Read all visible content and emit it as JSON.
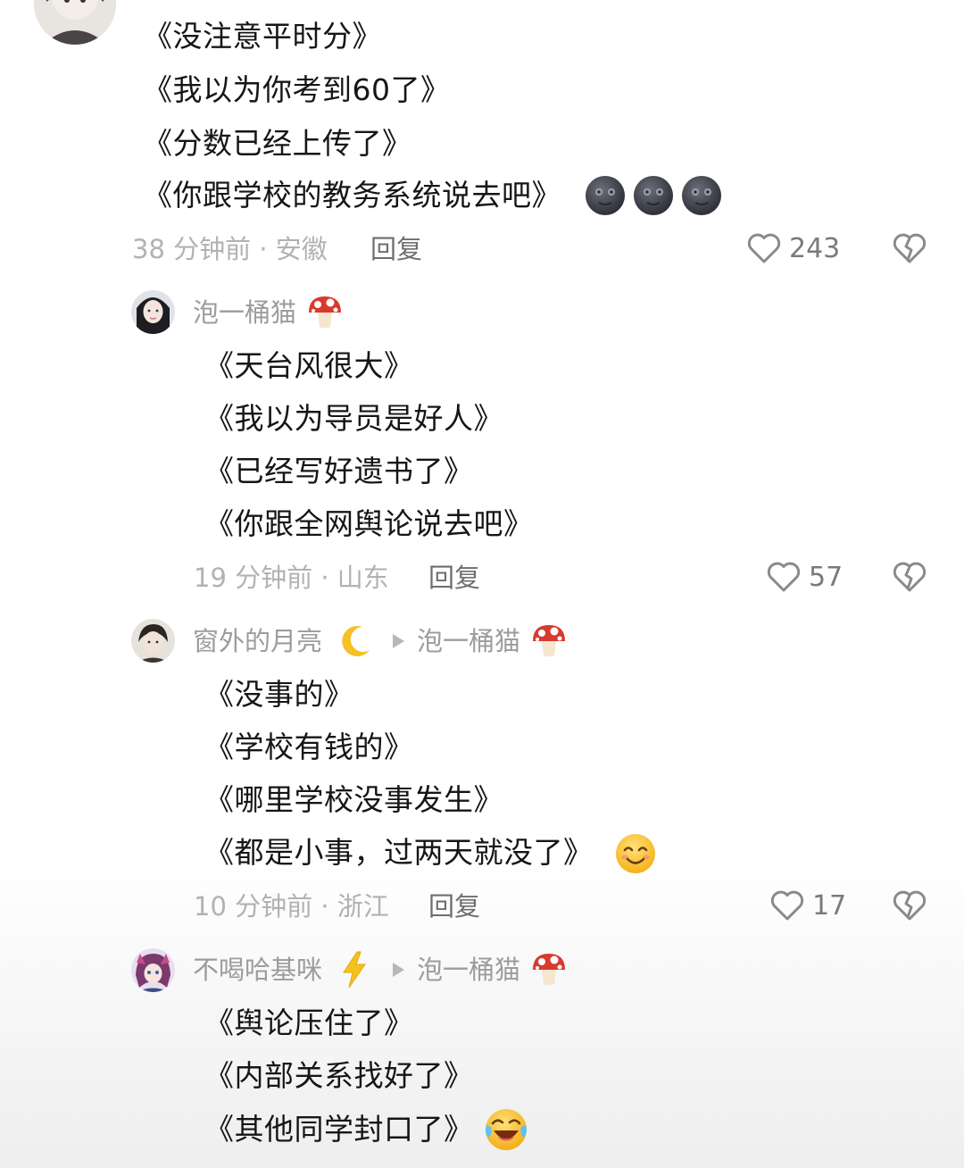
{
  "comments": [
    {
      "lines": [
        "《没注意平时分》",
        "《我以为你考到60了》",
        "《分数已经上传了》",
        "《你跟学校的教务系统说去吧》"
      ],
      "emoji": "new-moon-face",
      "time_location": "38 分钟前 · 安徽",
      "reply_label": "回复",
      "likes": "243"
    },
    {
      "user": "泡一桶猫",
      "user_emoji": "mushroom",
      "lines": [
        "《天台风很大》",
        "《我以为导员是好人》",
        "《已经写好遗书了》",
        "《你跟全网舆论说去吧》"
      ],
      "time_location": "19 分钟前 · 山东",
      "reply_label": "回复",
      "likes": "57"
    },
    {
      "user": "窗外的月亮",
      "user_emoji": "crescent-moon",
      "reply_to": "泡一桶猫",
      "lines": [
        "《没事的》",
        "《学校有钱的》",
        "《哪里学校没事发生》",
        "《都是小事，过两天就没了》"
      ],
      "emoji": "smiling-face",
      "time_location": "10 分钟前 · 浙江",
      "reply_label": "回复",
      "likes": "17"
    },
    {
      "user": "不喝哈基咪",
      "user_emoji": "lightning",
      "reply_to": "泡一桶猫",
      "lines": [
        "《舆论压住了》",
        "《内部关系找好了》",
        "《其他同学封口了》"
      ],
      "emoji": "laughing-face"
    }
  ],
  "colors": {
    "text": "#161616",
    "meta": "#b2b2b2",
    "username": "#9c9c9c",
    "reply": "#6e6e6e",
    "icon": "#8a8a8a"
  }
}
